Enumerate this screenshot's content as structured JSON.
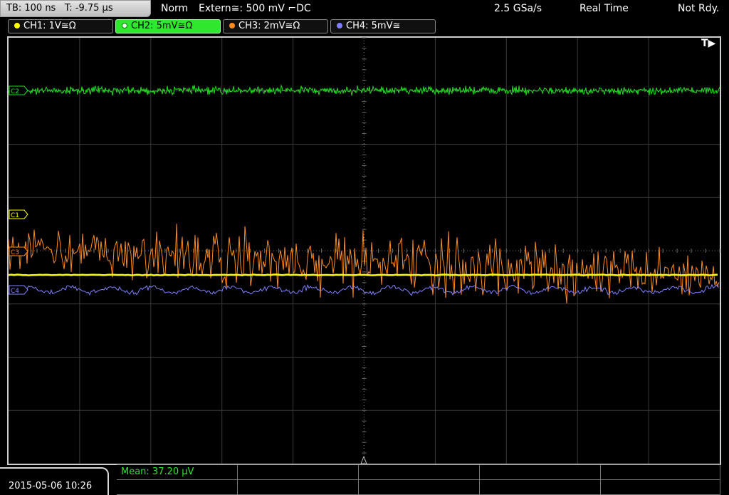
{
  "status": {
    "timebase": "TB: 100 ns",
    "trigger_time": "T: -9.75 µs",
    "trigger_mode": "Norm",
    "trigger_source": "Extern≅: 500 mV ⌐DC",
    "sample_rate": "2.5 GSa/s",
    "acq_mode": "Real Time",
    "trigger_status": "Not Rdy."
  },
  "channels": [
    {
      "label": "CH1: 1V≅Ω",
      "color": "#ffff00",
      "marker": "C1",
      "active": false
    },
    {
      "label": "CH2: 5mV≅Ω",
      "color": "#22dd22",
      "marker": "C2",
      "active": true
    },
    {
      "label": "CH3: 2mV≅Ω",
      "color": "#ff8c1a",
      "marker": "C3",
      "active": false
    },
    {
      "label": "CH4: 5mV≅",
      "color": "#8080ff",
      "marker": "C4",
      "active": false
    }
  ],
  "trigger_marker": "T▶",
  "measurement": {
    "mean": "Mean: 37.20 µV"
  },
  "datetime": "2015-05-06 10:26",
  "colors": {
    "grid": "#3a3a3a",
    "grid_center": "#6a6a6a",
    "frame": "#cfcfcf"
  }
}
